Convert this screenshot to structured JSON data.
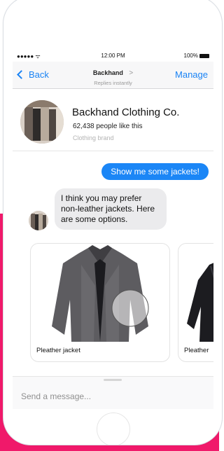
{
  "status_bar": {
    "signal": "●●●●● ",
    "time": "12:00 PM",
    "battery": "100%"
  },
  "nav": {
    "back_label": "Back",
    "title": "Backhand",
    "title_caret": ">",
    "subtitle": "Replies instantly",
    "manage_label": "Manage"
  },
  "profile": {
    "name": "Backhand Clothing Co.",
    "likes": "62,438 people like this",
    "category": "Clothing brand"
  },
  "messages": {
    "outgoing": "Show me some jackets!",
    "incoming": "I think you may prefer non-leather jackets. Here are some options."
  },
  "cards": [
    {
      "label": "Pleather jacket",
      "icon": "gray-jacket-image"
    },
    {
      "label": "Pleather",
      "icon": "black-jacket-image"
    }
  ],
  "composer": {
    "placeholder": "Send a message..."
  },
  "colors": {
    "accent": "#1b86f6",
    "brand_pink": "#f0196a",
    "bubble_in": "#ebebed"
  }
}
